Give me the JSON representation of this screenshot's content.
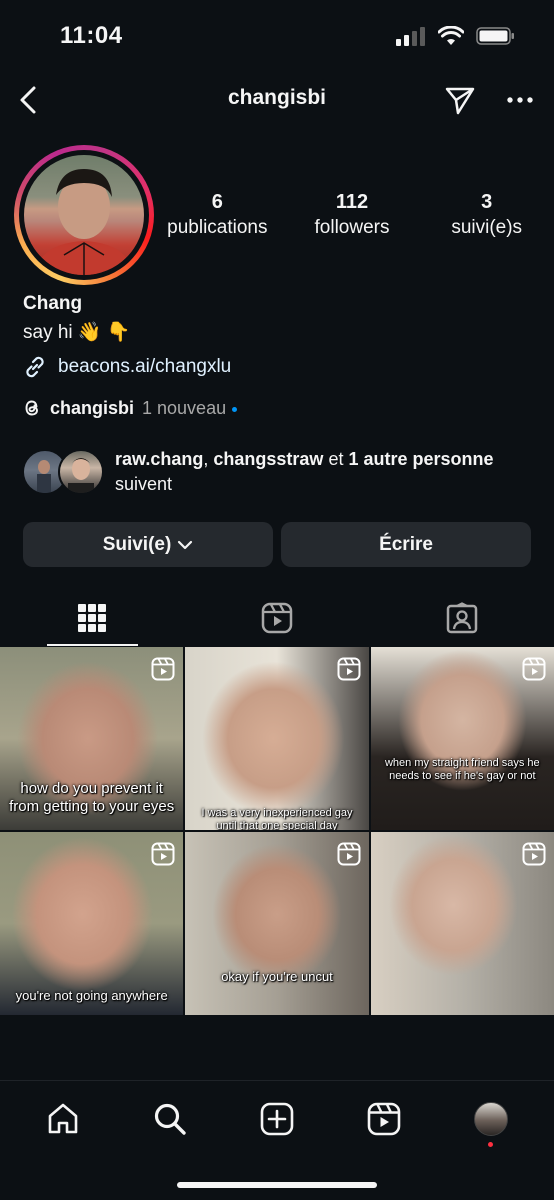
{
  "status_bar": {
    "time": "11:04"
  },
  "header": {
    "username": "changisbi"
  },
  "profile": {
    "stats": [
      {
        "num": "6",
        "label": "publications"
      },
      {
        "num": "112",
        "label": "followers"
      },
      {
        "num": "3",
        "label": "suivi(e)s"
      }
    ],
    "name": "Chang",
    "bio": "say hi 👋 👇",
    "link": "beacons.ai/changxlu",
    "threads_handle": "changisbi",
    "threads_new": "1 nouveau",
    "mutual": {
      "user1": "raw.chang",
      "sep1": ",",
      "user2": "changsstraw",
      "and": "et",
      "others": "1 autre personne",
      "follow": "suivent"
    }
  },
  "buttons": {
    "following": "Suivi(e)",
    "message": "Écrire"
  },
  "grid": [
    {
      "caption": "how do you prevent it from getting to your eyes"
    },
    {
      "caption": "I was a very inexperienced gay until that one special day"
    },
    {
      "caption": "when my straight friend says he needs to see if he's gay or not"
    },
    {
      "caption": "you're not going anywhere"
    },
    {
      "caption": "okay if you're uncut"
    },
    {
      "caption": ""
    }
  ],
  "colors": {
    "background": "#0c1014",
    "button": "#25292e",
    "link": "#e0f1ff",
    "notification": "#ff3040",
    "accent": "#0095f6"
  }
}
